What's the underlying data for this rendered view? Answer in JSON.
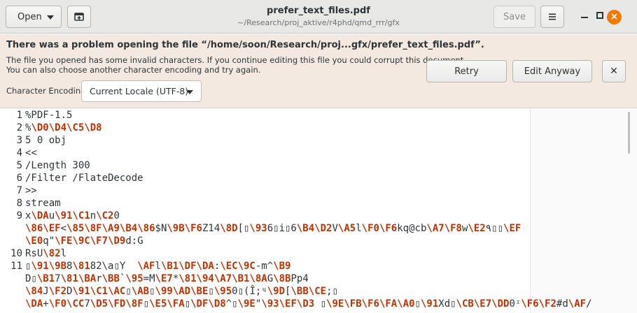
{
  "header": {
    "open_label": "Open",
    "title": "prefer_text_files.pdf",
    "subtitle": "~/Research/proj_aktive/r4phd/qmd_rrr/gfx",
    "save_label": "Save",
    "close_glyph": "×"
  },
  "infobar": {
    "title": "There was a problem opening the file “/home/soon/Research/proj...gfx/prefer_text_files.pdf”.",
    "message_line1": "The file you opened has some invalid characters. If you continue editing this file you could corrupt this document.",
    "message_line2": "You can also choose another character encoding and try again.",
    "encoding_label": "Character Encoding:",
    "encoding_value": "Current Locale (UTF-8)",
    "retry_label": "Retry",
    "edit_anyway_label": "Edit Anyway",
    "close_glyph": "✕"
  },
  "editor": {
    "line_numbers": [
      "1",
      "2",
      "3",
      "4",
      "5",
      "6",
      "7",
      "8",
      "9",
      "10",
      "11"
    ],
    "lines": [
      "%PDF-1.5",
      "%\\D0\\D4\\C5\\D8",
      "5 0 obj",
      "<<",
      "/Length 300",
      "/Filter /FlateDecode",
      ">>",
      "stream",
      "x\\DAu\\91\\C1n\\C20",
      "\\86\\EF<\\85\\8F\\A9\\B4\\86$N\\9B\\F6Z14\\8D[▯\\936▯i▯6\\B4\\D2V\\A5l\\F0\\F6kq@cb\\A7\\F8w\\E2٩▯▯\\EF",
      "\\E0q\"\\FE\\9C\\F7\\D9d:G",
      "RsU\\82l",
      "▯\\91\\9B8\\8182\\a▯Y  \\AFl\\B1\\DF\\DA:\\EC\\9C-m^\\B9",
      "D▯\\B17\\81\\BAr\\BB`\\95=M\\E7*\\81\\94\\A7\\B1\\8AG\\8BPp4",
      "\\84J\\F2D\\91\\C1\\AC▯\\AB▯\\99\\AD\\BE▯\\950▯(Î;ᶣ\\9D[\\BB\\CE;▯",
      "\\DA+\\F0\\CC7\\D5\\FD\\8F▯\\E5\\FA▯\\DF\\D8^▯\\9E\"\\93\\EF\\D3 ▯\\9E\\FB\\F6\\FA\\A0▯\\91Xd▯\\CB\\E7\\DD0ᶦ\\F6\\F2#d\\AF/"
    ]
  }
}
